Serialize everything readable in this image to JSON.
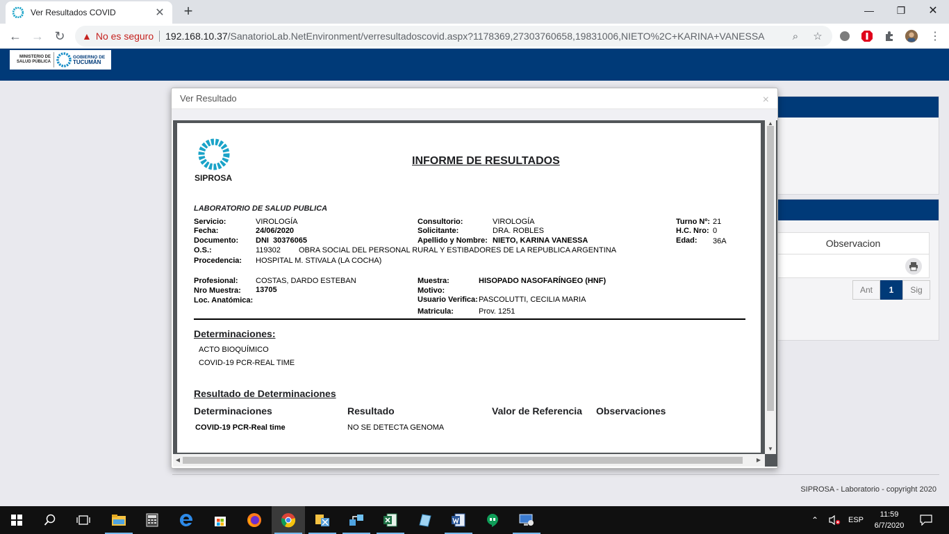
{
  "browser": {
    "tab_title": "Ver Resultados COVID",
    "insecure_label": "No es seguro",
    "url_host": "192.168.10.37",
    "url_path": "/SanatorioLab.NetEnvironment/verresultadoscovid.aspx?1178369,27303760658,19831006,NIETO%2C+KARINA+VANESSA"
  },
  "header": {
    "logo_left_line1": "MINISTERIO DE",
    "logo_left_line2": "SALUD PÚBLICA",
    "logo_right_line1": "GOBIERNO DE",
    "logo_right_line2": "TUCUMÁN"
  },
  "background": {
    "observacion_label": "Observacion",
    "pager": {
      "prev": "Ant",
      "current": "1",
      "next": "Sig"
    },
    "footer": "SIPROSA - Laboratorio - copyright 2020"
  },
  "modal": {
    "title": "Ver Resultado",
    "close": "×"
  },
  "report": {
    "org": "SIPROSA",
    "title": "INFORME DE RESULTADOS",
    "lab": "LABORATORIO DE SALUD PUBLICA",
    "servicio_label": "Servicio:",
    "servicio": "VIROLOGÍA",
    "fecha_label": "Fecha:",
    "fecha": "24/06/2020",
    "documento_label": "Documento:",
    "documento": "DNI  30376065",
    "os_label": "O.S.:",
    "os_code": "119302",
    "os_name": "OBRA SOCIAL DEL PERSONAL RURAL Y ESTIBADORES DE LA REPUBLICA ARGENTINA",
    "procedencia_label": "Procedencia:",
    "procedencia": "HOSPITAL M. STIVALA (LA COCHA)",
    "consultorio_label": "Consultorio:",
    "consultorio": "VIROLOGÍA",
    "solicitante_label": "Solicitante:",
    "solicitante": "DRA. ROBLES",
    "apellido_label": "Apellido y Nombre:",
    "apellido": "NIETO, KARINA VANESSA",
    "turno_label": "Turno Nº:",
    "turno": "21",
    "hc_label": "H.C. Nro:",
    "hc": "0",
    "edad_label": "Edad:",
    "edad": "36A",
    "profesional_label": "Profesional:",
    "profesional": "COSTAS, DARDO ESTEBAN",
    "nro_muestra_label": "Nro Muestra:",
    "nro_muestra": "13705",
    "loc_label": "Loc. Anatómica:",
    "muestra_label": "Muestra:",
    "muestra": "HISOPADO NASOFARÍNGEO (HNF)",
    "motivo_label": "Motivo:",
    "usuario_label": "Usuario Verifica:",
    "usuario": "PASCOLUTTI, CECILIA MARIA",
    "matricula_label": "Matricula:",
    "matricula": "Prov. 1251",
    "determinaciones_title": "Determinaciones:",
    "determinaciones": [
      "ACTO BIOQUÍMICO",
      "COVID-19 PCR-REAL TIME"
    ],
    "resultado_title": "Resultado de Determinaciones",
    "columns": [
      "Determinaciones",
      "Resultado",
      "Valor de Referencia",
      "Observaciones"
    ],
    "row": {
      "determinacion": "COVID-19 PCR-Real time",
      "resultado": "NO SE DETECTA GENOMA"
    }
  },
  "taskbar": {
    "lang": "ESP",
    "time": "11:59",
    "date": "6/7/2020"
  }
}
